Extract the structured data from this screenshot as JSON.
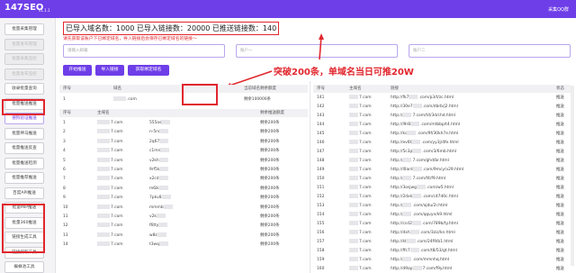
{
  "app": {
    "name": "147SEO",
    "version": "v1.1.1",
    "account": "采集QQ群"
  },
  "sidebar": {
    "items": [
      {
        "label": "批量采集管理"
      },
      {
        "label": "批量发布管理"
      },
      {
        "label": "批量采集监控"
      },
      {
        "label": "批量发布监控"
      },
      {
        "label": "收录批量查询"
      },
      {
        "label": "批量推送推送"
      },
      {
        "label": "搜狗验证推送"
      },
      {
        "label": "批量神马推送"
      },
      {
        "label": "批量推送反查"
      },
      {
        "label": "批量推送检测"
      },
      {
        "label": "批量推荐推送"
      },
      {
        "label": "百度API推送"
      },
      {
        "label": "批量MIP推送"
      },
      {
        "label": "批量360推送"
      },
      {
        "label": "链接生成工具"
      },
      {
        "label": "链接抓取工具"
      },
      {
        "label": "蜘蛛池工具"
      }
    ]
  },
  "stats": {
    "text": "已导入域名数：1000 已导入链接数：20000 已推送链接数：140"
  },
  "notice": "请先获取该账户下已绑定域名，导入链接后会保存已绑定域名的链接～",
  "inputs": {
    "email_placeholder": "请输入邮箱",
    "cookie_placeholder": "账户一",
    "password_placeholder": "账户二"
  },
  "buttons": {
    "start": "开始推送",
    "import": "导入链接",
    "refresh": "获取绑定域名"
  },
  "callout": "突破200条，单域名当日可推20W",
  "domain_table": {
    "headers": {
      "num": "序号",
      "domain": "域名",
      "quota": "当前域名剩余额度"
    },
    "first_row": {
      "num": "1",
      "domain": ".com",
      "quota": "剩余100000条"
    }
  },
  "quota_table": {
    "headers": {
      "num": "序号",
      "domain": "主域名",
      "quota": "剩余推送额度"
    },
    "rows": [
      {
        "num": "1",
        "domain": "7.com",
        "link": "555as",
        "quota": "剩余200条"
      },
      {
        "num": "2",
        "domain": "7.com",
        "link": "n-5rs",
        "quota": "剩余200条"
      },
      {
        "num": "3",
        "domain": "7.com",
        "link": "2q67",
        "quota": "剩余200条"
      },
      {
        "num": "4",
        "domain": "7.com",
        "link": "c1mn",
        "quota": "剩余200条"
      },
      {
        "num": "5",
        "domain": "7.com",
        "link": "v2kh",
        "quota": "剩余200条"
      },
      {
        "num": "6",
        "domain": "7.com",
        "link": "9rf5k",
        "quota": "剩余200条"
      },
      {
        "num": "7",
        "domain": "7.com",
        "link": "x2cd",
        "quota": "剩余200条"
      },
      {
        "num": "8",
        "domain": "7.com",
        "link": "m6ik",
        "quota": "剩余200条"
      },
      {
        "num": "9",
        "domain": "7.com",
        "link": "7pkv8",
        "quota": "剩余200条"
      },
      {
        "num": "10",
        "domain": "7.com",
        "link": "mmmb",
        "quota": "剩余200条"
      },
      {
        "num": "11",
        "domain": "7.com",
        "link": "v2k",
        "quota": "剩余200条"
      },
      {
        "num": "12",
        "domain": "7.com",
        "link": "f6tty",
        "quota": "剩余200条"
      },
      {
        "num": "13",
        "domain": "7.com",
        "link": "w8z",
        "quota": "剩余200条"
      },
      {
        "num": "14",
        "domain": "7.com",
        "link": "t3wq",
        "quota": "剩余200条"
      }
    ]
  },
  "link_table": {
    "headers": {
      "num": "序号",
      "domain": "主域名",
      "link": "链接",
      "status": "状态"
    },
    "rows": [
      {
        "num": "141",
        "domain": "7.com",
        "link": "http://fk7",
        "path": ".com/p3/t/zc.html",
        "status": "推送"
      },
      {
        "num": "142",
        "domain": "7.com",
        "link": "http://30e7",
        "path": ".com/dbrb/j2.html",
        "status": "推送"
      },
      {
        "num": "143",
        "domain": "7.com",
        "link": "http://",
        "path": "7.com/t4/3d/chd.html",
        "status": "推送"
      },
      {
        "num": "144",
        "domain": "7.com",
        "link": "http://l9r8",
        "path": ".com/mtbbp/t4.html",
        "status": "推送"
      },
      {
        "num": "145",
        "domain": "7.com",
        "link": "http://kc",
        "path": ".com/9f/30kh7e.html",
        "status": "推送"
      },
      {
        "num": "146",
        "domain": "7.com",
        "link": "http://ev6t",
        "path": ".com/yy3j/4fe.html",
        "status": "推送"
      },
      {
        "num": "147",
        "domain": "7.com",
        "link": "http://5c3p",
        "path": ".com/3/6mb.html",
        "status": "推送"
      },
      {
        "num": "148",
        "domain": "7.com",
        "link": "http://",
        "path": "7.com/ghd/br.html",
        "status": "推送"
      },
      {
        "num": "149",
        "domain": "7.com",
        "link": "http://l0ard",
        "path": ".com/9mcy/v29.html",
        "status": "推送"
      },
      {
        "num": "150",
        "domain": "7.com",
        "link": "http://",
        "path": "7.com/f4/f9.html",
        "status": "推送"
      },
      {
        "num": "151",
        "domain": "7.com",
        "link": "http://3osjwg",
        "path": ".com/w5.html",
        "status": "推送"
      },
      {
        "num": "152",
        "domain": "7.com",
        "link": "http://2dxk",
        "path": ".com/c47d0c.html",
        "status": "推送"
      },
      {
        "num": "153",
        "domain": "7.com",
        "link": "http://",
        "path": ".com/ajdu/2r.html",
        "status": "推送"
      },
      {
        "num": "154",
        "domain": "7.com",
        "link": "http://",
        "path": ".com/qqvyn/k9.html",
        "status": "推送"
      },
      {
        "num": "155",
        "domain": "7.com",
        "link": "http://ccd2",
        "path": ".com/789b/ty.html",
        "status": "推送"
      },
      {
        "num": "156",
        "domain": "7.com",
        "link": "http://dxh",
        "path": ".com/3ziz/kn.html",
        "status": "推送"
      },
      {
        "num": "157",
        "domain": "7.com",
        "link": "http://kt",
        "path": ".com/24f9/b1.html",
        "status": "推送"
      },
      {
        "num": "158",
        "domain": "7.com",
        "link": "http://ffc7",
        "path": ".com/t8/53/gt.html",
        "status": "推送"
      },
      {
        "num": "159",
        "domain": "7.com",
        "link": "http://",
        "path": ".com/mmnhq.html",
        "status": "推送"
      },
      {
        "num": "160",
        "domain": "7.com",
        "link": "http://d9ap",
        "path": "7.com/f9y.html",
        "status": "推送"
      }
    ]
  },
  "colors": {
    "accent": "#6e3ee8",
    "highlight": "#e1262d"
  }
}
